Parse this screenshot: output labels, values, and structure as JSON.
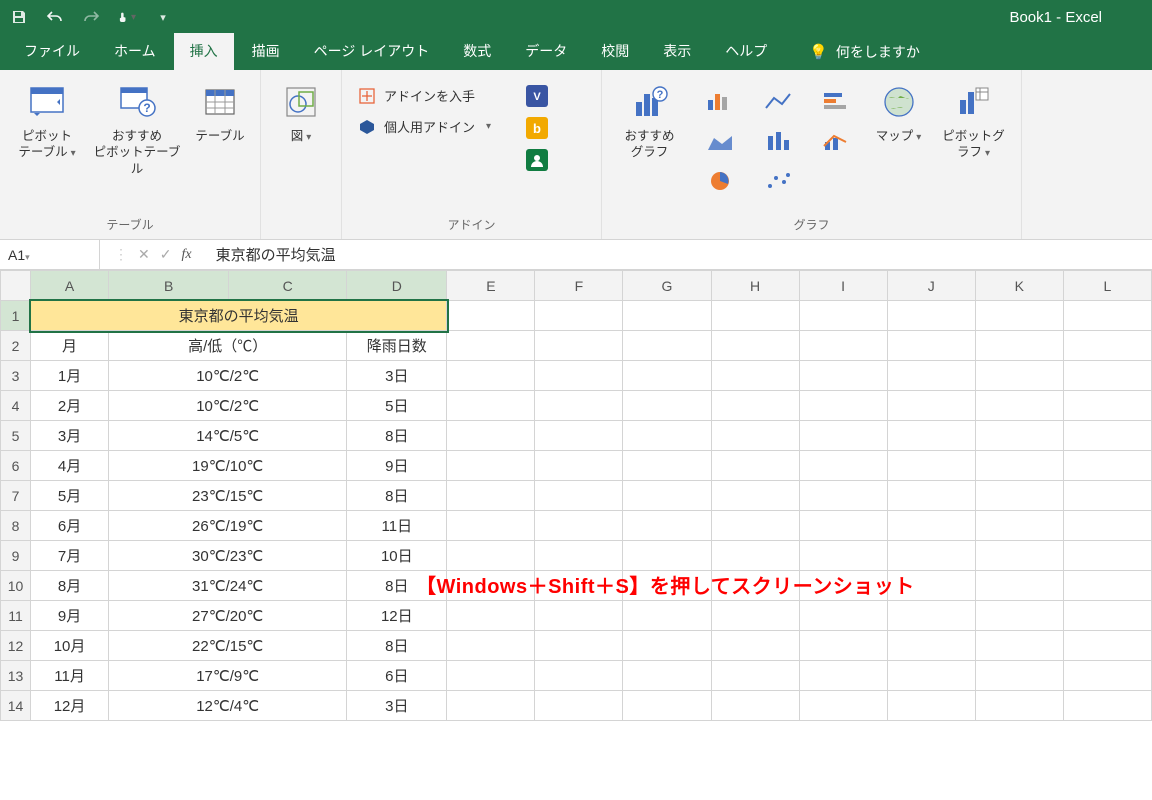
{
  "app": {
    "title": "Book1  -  Excel"
  },
  "tabs": {
    "file": "ファイル",
    "home": "ホーム",
    "insert": "挿入",
    "draw": "描画",
    "pagelayout": "ページ レイアウト",
    "formulas": "数式",
    "data": "データ",
    "review": "校閲",
    "view": "表示",
    "help": "ヘルプ",
    "tellme": "何をしますか"
  },
  "ribbon": {
    "tables": {
      "label": "テーブル",
      "pivot": "ピボット\nテーブル",
      "recpivot": "おすすめ\nピボットテーブル",
      "table": "テーブル"
    },
    "illust": {
      "label": "",
      "shapes": "図"
    },
    "addins": {
      "label": "アドイン",
      "get": "アドインを入手",
      "my": "個人用アドイン"
    },
    "charts": {
      "label": "グラフ",
      "rec": "おすすめ\nグラフ",
      "map": "マップ",
      "pivotchart": "ピボットグラフ"
    }
  },
  "namebox": "A1",
  "formula": "東京都の平均気温",
  "columns": [
    "A",
    "B",
    "C",
    "D",
    "E",
    "F",
    "G",
    "H",
    "I",
    "J",
    "K",
    "L"
  ],
  "sheet": {
    "title": "東京都の平均気温",
    "headers": {
      "month": "月",
      "hilo": "高/低（℃）",
      "rain": "降雨日数"
    },
    "rows": [
      {
        "m": "1月",
        "t": "10℃/2℃",
        "r": "3日"
      },
      {
        "m": "2月",
        "t": "10℃/2℃",
        "r": "5日"
      },
      {
        "m": "3月",
        "t": "14℃/5℃",
        "r": "8日"
      },
      {
        "m": "4月",
        "t": "19℃/10℃",
        "r": "9日"
      },
      {
        "m": "5月",
        "t": "23℃/15℃",
        "r": "8日"
      },
      {
        "m": "6月",
        "t": "26℃/19℃",
        "r": "11日"
      },
      {
        "m": "7月",
        "t": "30℃/23℃",
        "r": "10日"
      },
      {
        "m": "8月",
        "t": "31℃/24℃",
        "r": "8日"
      },
      {
        "m": "9月",
        "t": "27℃/20℃",
        "r": "12日"
      },
      {
        "m": "10月",
        "t": "22℃/15℃",
        "r": "8日"
      },
      {
        "m": "11月",
        "t": "17℃/9℃",
        "r": "6日"
      },
      {
        "m": "12月",
        "t": "12℃/4℃",
        "r": "3日"
      }
    ]
  },
  "overlay": "【Windows＋Shift＋S】を押してスクリーンショット"
}
